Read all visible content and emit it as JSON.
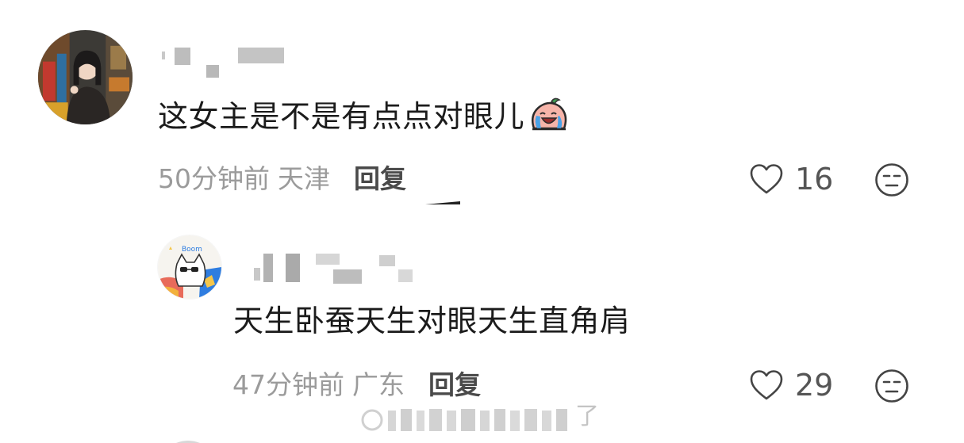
{
  "comments": [
    {
      "text": "这女主是不是有点点对眼儿",
      "emoji": "crying-laughing-peach-emoji",
      "time": "50分钟前",
      "location": "天津",
      "reply_label": "回复",
      "likes": "16"
    },
    {
      "text": "天生卧蚕天生对眼天生直角肩",
      "time": "47分钟前",
      "location": "广东",
      "reply_label": "回复",
      "likes": "29"
    }
  ],
  "watermark": {
    "text": "了"
  },
  "colors": {
    "meta_text": "#9b9b9b",
    "reply_text": "#4a4a4a",
    "redacted": "#bdbdbd",
    "icon_stroke": "#444444"
  },
  "icons": {
    "like": "heart-outline-icon",
    "dislike": "meh-face-icon"
  }
}
